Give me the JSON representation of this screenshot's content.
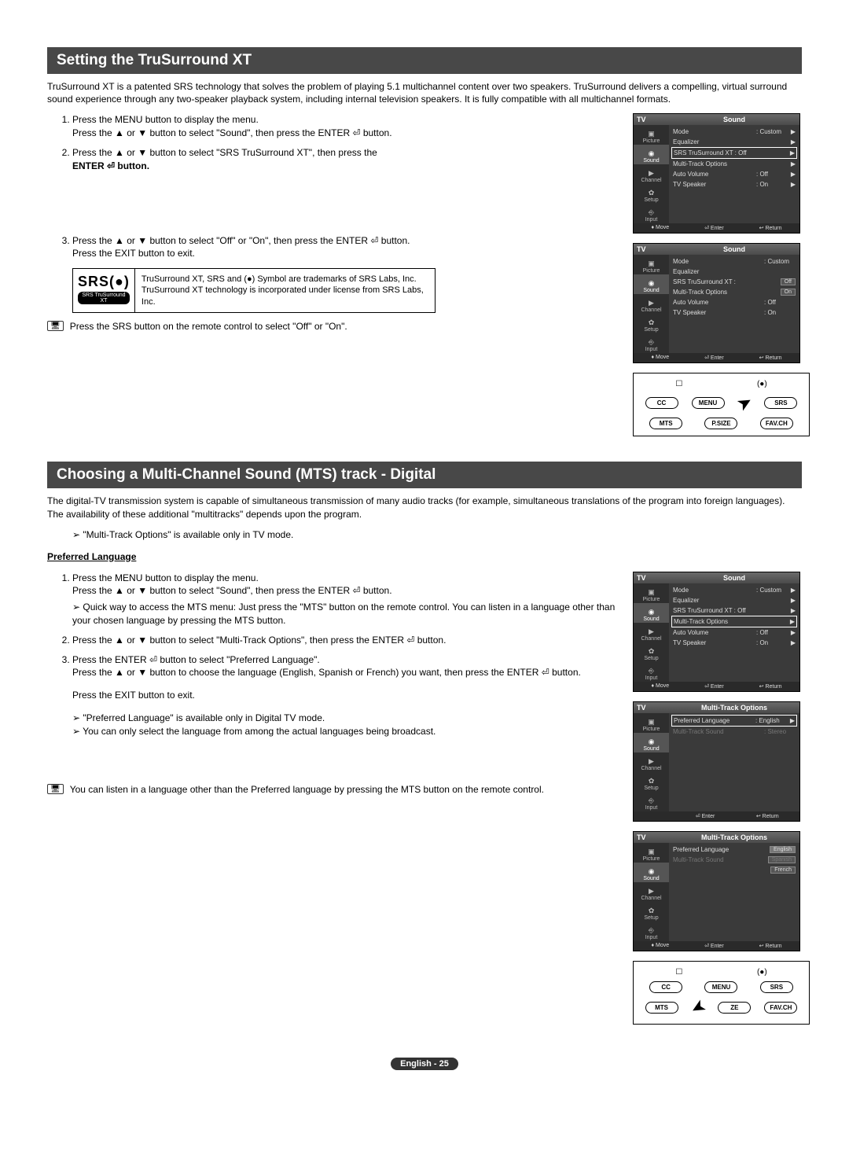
{
  "section1": {
    "title": "Setting the TruSurround XT",
    "intro": "TruSurround XT is a patented SRS technology that solves the problem of playing 5.1 multichannel content over two speakers. TruSurround delivers a compelling, virtual surround sound experience through any two-speaker playback system, including internal television speakers. It is fully compatible with all multichannel formats.",
    "step1a": "Press the MENU button to display the menu.",
    "step1b": "Press the ▲ or ▼ button to select \"Sound\", then press the ENTER ⏎ button.",
    "step2a": "Press the ▲ or ▼ button to select \"SRS TruSurround XT\", then press the",
    "step2b": "ENTER ⏎ button.",
    "step3a": "Press the ▲ or ▼ button to select \"Off\" or \"On\", then press the ENTER ⏎ button.",
    "step3b": "Press the EXIT button to exit.",
    "srs_logo": "SRS",
    "srs_logo_sym": "(●)",
    "srs_badge": "SRS TruSurround XT",
    "srs_text": "TruSurround XT, SRS and (●) Symbol are trademarks of SRS Labs, Inc. TruSurround XT technology is incorporated under license from SRS Labs, Inc.",
    "hint": "Press the SRS button on the remote control to select \"Off\" or \"On\"."
  },
  "section2": {
    "title": "Choosing a Multi-Channel Sound (MTS) track - Digital",
    "intro": "The digital-TV transmission system is capable of simultaneous transmission of many audio tracks (for example, simultaneous translations of the program into foreign languages). The availability of these additional \"multitracks\" depends upon the program.",
    "note1": "\"Multi-Track Options\" is available only in TV mode.",
    "heading": "Preferred Language",
    "step1a": "Press the MENU button to display the menu.",
    "step1b": "Press the ▲ or ▼ button to select \"Sound\", then press the ENTER ⏎ button.",
    "step1note": "Quick way to access the MTS menu: Just press the \"MTS\" button on the remote control. You can listen in a language other than your chosen language by pressing the MTS button.",
    "step2": "Press the ▲ or ▼ button to select \"Multi-Track Options\", then press the ENTER ⏎ button.",
    "step3a": "Press the ENTER ⏎ button to select \"Preferred Language\".",
    "step3b": "Press the ▲ or ▼ button to choose the language (English, Spanish or French) you want, then press the ENTER ⏎ button.",
    "step3c": "Press the EXIT button to exit.",
    "note2": "\"Preferred Language\" is available only in Digital TV mode.",
    "note3": "You can only select the language from among the actual languages being broadcast.",
    "hint": "You can listen in a language other than the Preferred language by pressing the MTS button on the remote control."
  },
  "osd": {
    "tv": "TV",
    "sound": "Sound",
    "mto": "Multi-Track Options",
    "tabs": {
      "picture": "Picture",
      "sound": "Sound",
      "channel": "Channel",
      "setup": "Setup",
      "input": "Input"
    },
    "items": {
      "mode": "Mode",
      "mode_v": ": Custom",
      "eq": "Equalizer",
      "srs": "SRS TruSurround XT : Off",
      "srs2": "SRS TruSurround XT :",
      "mtopt": "Multi-Track Options",
      "av": "Auto Volume",
      "av_v": ": Off",
      "tvspk": "TV Speaker",
      "tvspk_v": ": On",
      "off": "Off",
      "on": "On",
      "preflang": "Preferred Language",
      "preflang_v": ": English",
      "mtsound": "Multi-Track Sound",
      "mtsound_v": ": Stereo",
      "english": "English",
      "spanish": "Spanish",
      "french": "French"
    },
    "foot": {
      "move": "♦ Move",
      "enter": "⏎ Enter",
      "return": "↩ Return"
    }
  },
  "remote": {
    "cc": "CC",
    "menu": "MENU",
    "srs": "SRS",
    "mts": "MTS",
    "psize": "P.SIZE",
    "ze": "ZE",
    "favch": "FAV.CH"
  },
  "footer": "English - 25"
}
